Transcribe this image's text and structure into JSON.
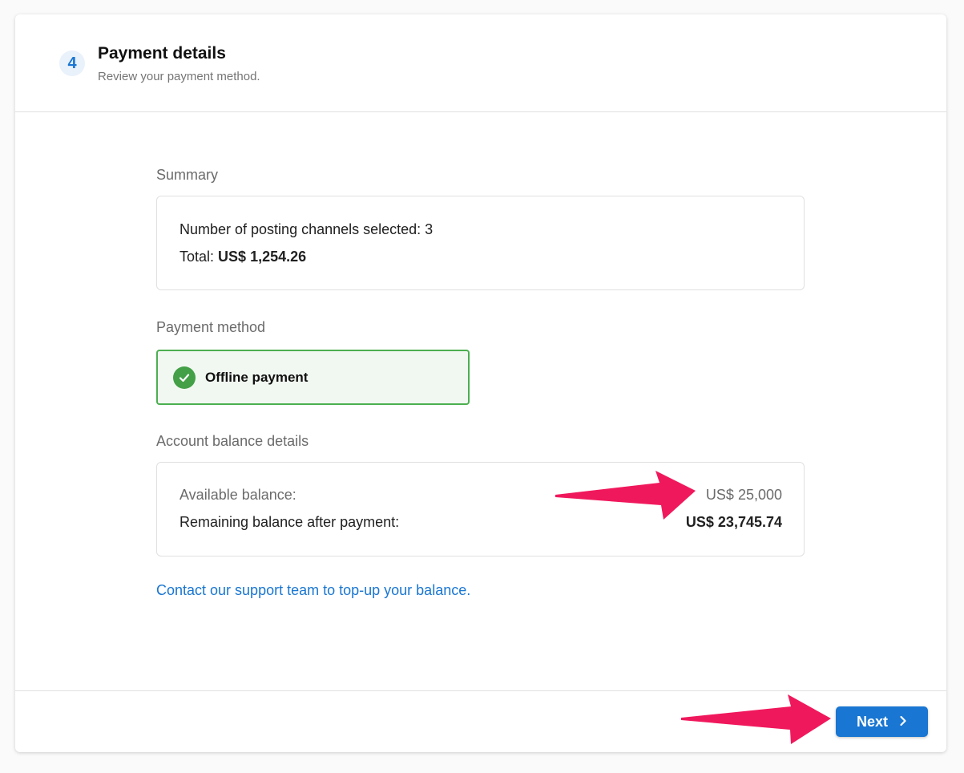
{
  "header": {
    "step_number": "4",
    "title": "Payment details",
    "subtitle": "Review your payment method."
  },
  "summary": {
    "label": "Summary",
    "channels_text": "Number of posting channels selected: 3",
    "total_prefix": "Total:",
    "total_value": "US$ 1,254.26"
  },
  "payment_method": {
    "label": "Payment method",
    "selected": "Offline payment",
    "icon": "check-circle-icon"
  },
  "balance": {
    "label": "Account balance details",
    "available_label": "Available balance:",
    "available_value": "US$ 25,000",
    "remaining_label": "Remaining balance after payment:",
    "remaining_value": "US$ 23,745.74"
  },
  "support_link": "Contact our support team to top-up your balance.",
  "footer": {
    "next_label": "Next",
    "next_icon": "chevron-right-icon"
  },
  "colors": {
    "accent": "#1976d2",
    "success": "#43a047",
    "annotation_arrow": "#f0185c"
  }
}
